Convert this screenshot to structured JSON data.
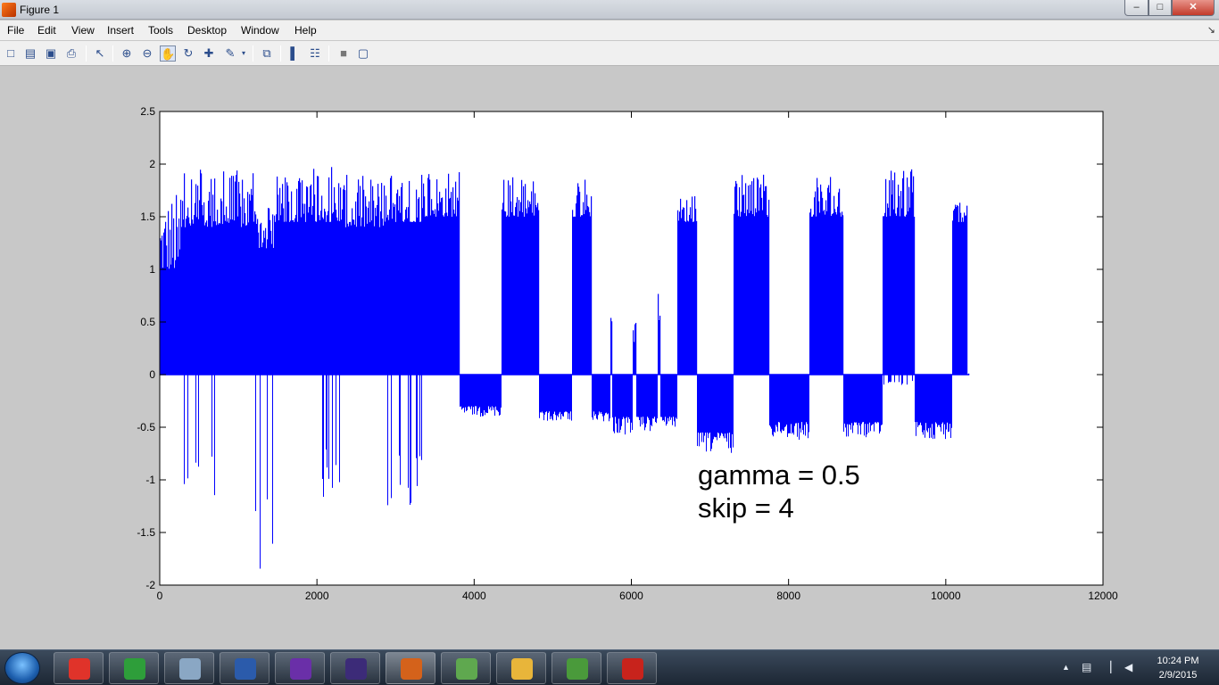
{
  "window": {
    "title": "Figure 1",
    "controls": {
      "minimize": "–",
      "maximize": "□",
      "close": "✕"
    }
  },
  "menu": {
    "items": [
      "File",
      "Edit",
      "View",
      "Insert",
      "Tools",
      "Desktop",
      "Window",
      "Help"
    ],
    "dock_arrow": "↘"
  },
  "toolbar": {
    "buttons": [
      {
        "name": "new-figure",
        "glyph": "□"
      },
      {
        "name": "open-file",
        "glyph": "▤"
      },
      {
        "name": "save-figure",
        "glyph": "▣"
      },
      {
        "name": "print-figure",
        "glyph": "⎙"
      },
      {
        "name": "edit-plot",
        "glyph": "↖"
      },
      {
        "name": "zoom-in",
        "glyph": "⊕"
      },
      {
        "name": "zoom-out",
        "glyph": "⊖"
      },
      {
        "name": "pan",
        "glyph": "✋",
        "pressed": true
      },
      {
        "name": "rotate-3d",
        "glyph": "↻"
      },
      {
        "name": "data-cursor",
        "glyph": "✚"
      },
      {
        "name": "brush",
        "glyph": "✎"
      },
      {
        "name": "link-plot",
        "glyph": "⧉"
      },
      {
        "name": "insert-colorbar",
        "glyph": "▌"
      },
      {
        "name": "insert-legend",
        "glyph": "☷"
      },
      {
        "name": "hide-plot-tools",
        "glyph": "■"
      },
      {
        "name": "show-plot-tools",
        "glyph": "▢"
      }
    ]
  },
  "chart_data": {
    "type": "bar",
    "description_units": "stem-like vertical bars from 0 for each sample index",
    "xlim": [
      0,
      12000
    ],
    "ylim": [
      -2,
      2.5
    ],
    "xticks": [
      0,
      2000,
      4000,
      6000,
      8000,
      10000,
      12000
    ],
    "yticks": [
      -2,
      -1.5,
      -1,
      -0.5,
      0,
      0.5,
      1,
      1.5,
      2,
      2.5
    ],
    "xtick_labels": [
      "0",
      "2000",
      "4000",
      "6000",
      "8000",
      "10000",
      "12000"
    ],
    "ytick_labels": [
      "-2",
      "-1.5",
      "-1",
      "-0.5",
      "0",
      "0.5",
      "1",
      "1.5",
      "2",
      "2.5"
    ],
    "series_color": "#0000ff",
    "grid": false,
    "samples": 10300,
    "segments": [
      {
        "x0": 0,
        "x1": 270,
        "pos_max": 1.75,
        "pos_base": 1.0,
        "neg_min": 0
      },
      {
        "x0": 270,
        "x1": 700,
        "pos_max": 1.95,
        "pos_base": 1.4,
        "neg_min": -1.2
      },
      {
        "x0": 700,
        "x1": 1200,
        "pos_max": 1.95,
        "pos_base": 1.4,
        "neg_min": 0
      },
      {
        "x0": 1200,
        "x1": 1450,
        "pos_max": 1.6,
        "pos_base": 1.2,
        "neg_min": -1.85
      },
      {
        "x0": 1450,
        "x1": 1900,
        "pos_max": 1.9,
        "pos_base": 1.45,
        "neg_min": 0
      },
      {
        "x0": 1900,
        "x1": 2300,
        "pos_max": 2.0,
        "pos_base": 1.45,
        "neg_min": -1.18
      },
      {
        "x0": 2300,
        "x1": 2850,
        "pos_max": 1.9,
        "pos_base": 1.4,
        "neg_min": 0
      },
      {
        "x0": 2850,
        "x1": 3350,
        "pos_max": 1.9,
        "pos_base": 1.45,
        "neg_min": -1.28
      },
      {
        "x0": 3350,
        "x1": 3820,
        "pos_max": 1.95,
        "pos_base": 1.5,
        "neg_min": 0
      },
      {
        "x0": 3820,
        "x1": 4350,
        "pos_max": 0,
        "pos_base": 0,
        "neg_min": -0.4,
        "neg_base": -0.3
      },
      {
        "x0": 4350,
        "x1": 4820,
        "pos_max": 1.88,
        "pos_base": 1.5,
        "neg_min": 0
      },
      {
        "x0": 4820,
        "x1": 5250,
        "pos_max": 0,
        "pos_base": 0,
        "neg_min": -0.45,
        "neg_base": -0.35
      },
      {
        "x0": 5250,
        "x1": 5500,
        "pos_max": 1.9,
        "pos_base": 1.5,
        "neg_min": 0
      },
      {
        "x0": 5500,
        "x1": 5730,
        "pos_max": 0,
        "pos_base": 0,
        "neg_min": -0.45,
        "neg_base": -0.35
      },
      {
        "x0": 5730,
        "x1": 5760,
        "pos_max": 0.78,
        "pos_base": 0.5,
        "neg_min": 0
      },
      {
        "x0": 5760,
        "x1": 6020,
        "pos_max": 0,
        "pos_base": 0,
        "neg_min": -0.58,
        "neg_base": -0.4
      },
      {
        "x0": 6020,
        "x1": 6060,
        "pos_max": 0.5,
        "pos_base": 0.3,
        "neg_min": 0
      },
      {
        "x0": 6060,
        "x1": 6330,
        "pos_max": 0,
        "pos_base": 0,
        "neg_min": -0.55,
        "neg_base": -0.4
      },
      {
        "x0": 6330,
        "x1": 6370,
        "pos_max": 0.82,
        "pos_base": 0.5,
        "neg_min": 0
      },
      {
        "x0": 6370,
        "x1": 6580,
        "pos_max": 0,
        "pos_base": 0,
        "neg_min": -0.5,
        "neg_base": -0.4
      },
      {
        "x0": 6580,
        "x1": 6830,
        "pos_max": 1.7,
        "pos_base": 1.45,
        "neg_min": 0
      },
      {
        "x0": 6830,
        "x1": 7300,
        "pos_max": 0,
        "pos_base": 0,
        "neg_min": -0.75,
        "neg_base": -0.55
      },
      {
        "x0": 7300,
        "x1": 7750,
        "pos_max": 1.9,
        "pos_base": 1.5,
        "neg_min": 0
      },
      {
        "x0": 7750,
        "x1": 8270,
        "pos_max": 0,
        "pos_base": 0,
        "neg_min": -0.62,
        "neg_base": -0.45
      },
      {
        "x0": 8270,
        "x1": 8700,
        "pos_max": 1.88,
        "pos_base": 1.5,
        "neg_min": 0
      },
      {
        "x0": 8700,
        "x1": 9200,
        "pos_max": 0,
        "pos_base": 0,
        "neg_min": -0.6,
        "neg_base": -0.45
      },
      {
        "x0": 9200,
        "x1": 9600,
        "pos_max": 1.97,
        "pos_base": 1.5,
        "neg_min": -0.1
      },
      {
        "x0": 9600,
        "x1": 10080,
        "pos_max": 0,
        "pos_base": 0,
        "neg_min": -0.62,
        "neg_base": -0.45
      },
      {
        "x0": 10080,
        "x1": 10270,
        "pos_max": 1.66,
        "pos_base": 1.45,
        "neg_min": 0
      },
      {
        "x0": 10270,
        "x1": 10300,
        "pos_max": 0.02,
        "pos_base": 0.0,
        "neg_min": 0
      }
    ],
    "annotations": [
      "gamma = 0.5",
      "skip = 4"
    ]
  },
  "taskbar": {
    "apps": [
      {
        "name": "chrome",
        "color": "#e0332a"
      },
      {
        "name": "task-manager",
        "color": "#2e9e3a"
      },
      {
        "name": "pin-app",
        "color": "#8aa7c4"
      },
      {
        "name": "word",
        "color": "#2b5bab"
      },
      {
        "name": "torrent",
        "color": "#6a2fa8"
      },
      {
        "name": "eclipse",
        "color": "#3c2b78"
      },
      {
        "name": "matlab",
        "color": "#d4621b",
        "active": true
      },
      {
        "name": "maps",
        "color": "#5fa84f"
      },
      {
        "name": "explorer",
        "color": "#e8b53a"
      },
      {
        "name": "chart-app",
        "color": "#4a9a3b"
      },
      {
        "name": "acrobat",
        "color": "#c8231c"
      }
    ],
    "clock": {
      "time": "10:24 PM",
      "date": "2/9/2015"
    },
    "tray_glyphs": {
      "show_hidden": "▲",
      "device": "▤",
      "network": "▕",
      "volume": "◀"
    }
  }
}
